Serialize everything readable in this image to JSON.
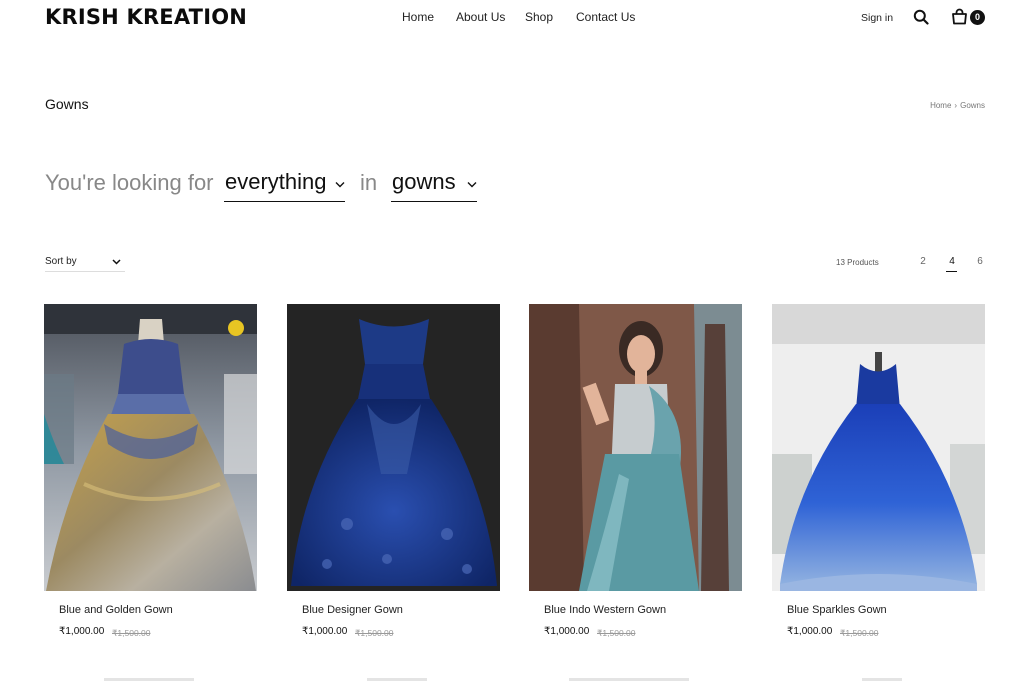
{
  "header": {
    "logo": "KRISH KREATION",
    "nav": {
      "home": "Home",
      "about": "About Us",
      "shop": "Shop",
      "contact": "Contact Us"
    },
    "sign_in": "Sign in",
    "cart_count": "0"
  },
  "page": {
    "title": "Gowns",
    "breadcrumb": {
      "home": "Home",
      "sep": "›",
      "current": "Gowns"
    }
  },
  "filter": {
    "prefix": "You're looking for",
    "category_value": "everything",
    "joiner": "in",
    "collection_value": "gowns"
  },
  "toolbar": {
    "sort_label": "Sort by",
    "product_count": "13 Products",
    "columns": [
      "2",
      "4",
      "6"
    ],
    "active_columns": "4"
  },
  "products": [
    {
      "name": "Blue and Golden Gown",
      "price": "₹1,000.00",
      "old_price": "₹1,500.00"
    },
    {
      "name": "Blue Designer Gown",
      "price": "₹1,000.00",
      "old_price": "₹1,500.00"
    },
    {
      "name": "Blue Indo Western Gown",
      "price": "₹1,000.00",
      "old_price": "₹1,500.00"
    },
    {
      "name": "Blue Sparkles Gown",
      "price": "₹1,000.00",
      "old_price": "₹1,500.00"
    }
  ],
  "icons": {
    "search": "search-icon",
    "cart": "shopping-bag-icon",
    "dropdown": "chevron-down-icon"
  },
  "colors": {
    "text": "#111111",
    "muted": "#888888",
    "badge": "#111111"
  }
}
